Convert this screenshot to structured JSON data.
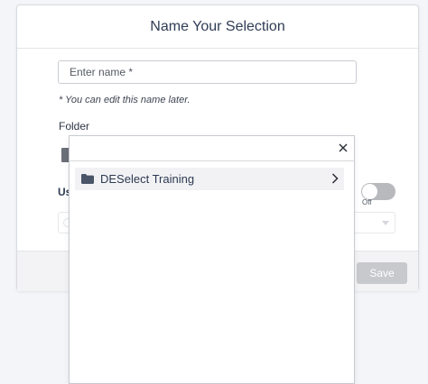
{
  "modal": {
    "title": "Name Your Selection",
    "name_placeholder": "Enter name *",
    "hint": "* You can edit this name later.",
    "folder_label": "Folder",
    "use_label": "Us",
    "toggle": {
      "state_label": "Off",
      "on": false
    },
    "save_label": "Save"
  },
  "folder_dropdown": {
    "close_icon": "close-icon",
    "items": [
      {
        "label": "DESelect Training",
        "icon": "folder-icon",
        "has_children": true
      }
    ]
  },
  "colors": {
    "title": "#2f3c55",
    "folder_icon": "#4a5568",
    "save_disabled": "#c7c9cc",
    "toggle_off": "#b7b9bd"
  }
}
